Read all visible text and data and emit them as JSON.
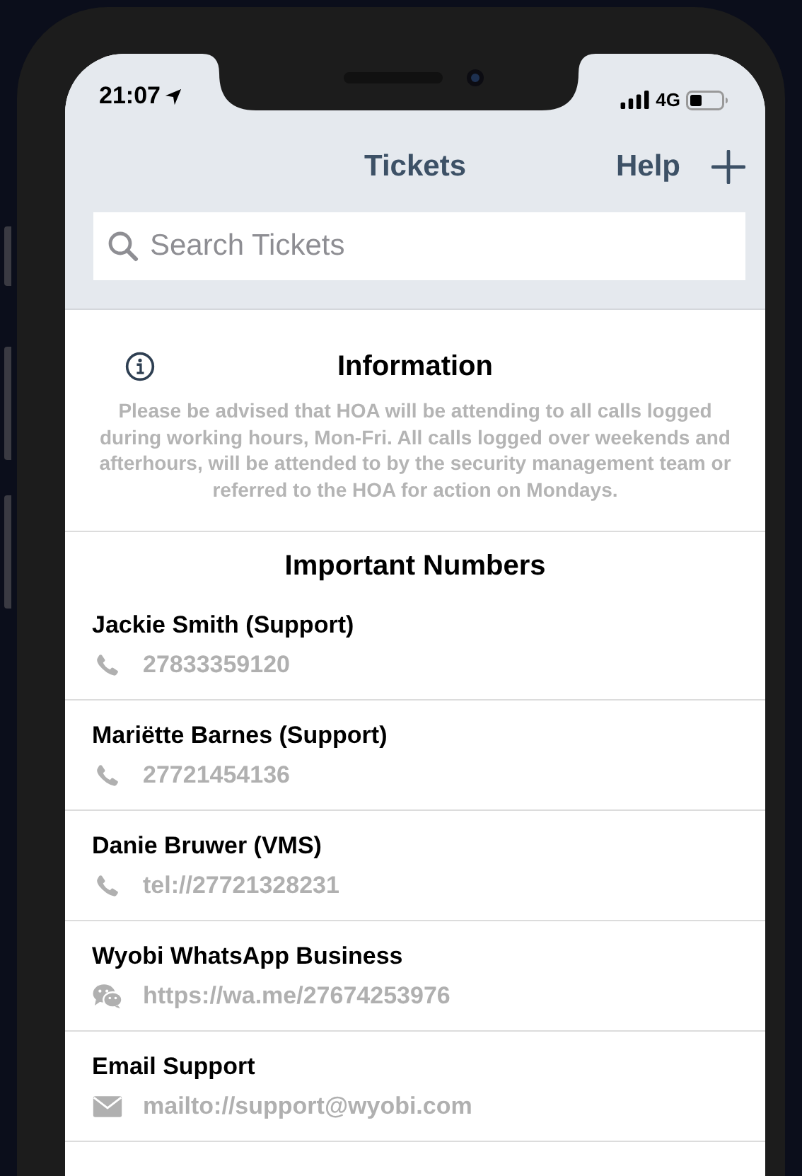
{
  "status_bar": {
    "time": "21:07",
    "network": "4G"
  },
  "nav": {
    "title": "Tickets",
    "help": "Help"
  },
  "search": {
    "placeholder": "Search Tickets"
  },
  "information": {
    "title": "Information",
    "body": "Please be advised that HOA will be attending to all calls logged during working hours, Mon-Fri. All calls  logged over weekends and afterhours, will be attended to by the security management team or referred to the HOA for action on Mondays."
  },
  "important_numbers": {
    "title": "Important Numbers",
    "contacts": [
      {
        "name": "Jackie Smith (Support)",
        "kind": "phone",
        "value": "27833359120"
      },
      {
        "name": "Mariëtte Barnes (Support)",
        "kind": "phone",
        "value": "27721454136"
      },
      {
        "name": "Danie Bruwer (VMS)",
        "kind": "phone",
        "value": "tel://27721328231"
      },
      {
        "name": "Wyobi WhatsApp Business",
        "kind": "chat",
        "value": "https://wa.me/27674253976"
      },
      {
        "name": "Email Support",
        "kind": "email",
        "value": "mailto://support@wyobi.com"
      }
    ]
  }
}
